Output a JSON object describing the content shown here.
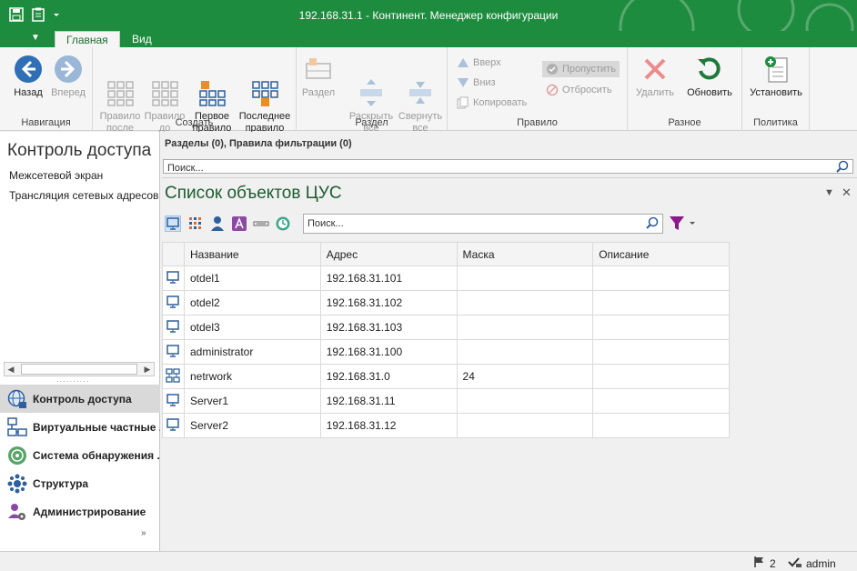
{
  "window": {
    "title": "192.168.31.1 - Континент. Менеджер конфигурации"
  },
  "ribbon": {
    "tabs": [
      {
        "label": "Главная",
        "active": true
      },
      {
        "label": "Вид",
        "active": false
      }
    ],
    "groups": {
      "navigation": {
        "label": "Навигация",
        "back": "Назад",
        "forward": "Вперед"
      },
      "create": {
        "label": "Создать",
        "rule_after": "Правило\nпосле",
        "rule_before": "Правило\nдо",
        "first_rule": "Первое\nправило",
        "last_rule": "Последнее\nправило"
      },
      "section": {
        "label": "Раздел",
        "section": "Раздел",
        "expand_all": "Раскрыть\nвсе",
        "collapse_all": "Свернуть\nвсе"
      },
      "rule": {
        "label": "Правило",
        "up": "Вверх",
        "down": "Вниз",
        "copy": "Копировать",
        "pass": "Пропустить",
        "drop": "Отбросить"
      },
      "misc": {
        "label": "Разное",
        "delete": "Удалить",
        "refresh": "Обновить"
      },
      "policy": {
        "label": "Политика",
        "install": "Установить"
      }
    }
  },
  "left_panel": {
    "title": "Контроль доступа",
    "tree": [
      "Межсетевой экран",
      "Трансляция сетевых адресов"
    ],
    "nav": [
      {
        "label": "Контроль доступа",
        "icon": "globe-lock-icon",
        "active": true
      },
      {
        "label": "Виртуальные частные ...",
        "icon": "network-icon",
        "active": false
      },
      {
        "label": "Система обнаружения ...",
        "icon": "radar-icon",
        "active": false
      },
      {
        "label": "Структура",
        "icon": "structure-icon",
        "active": false
      },
      {
        "label": "Администрирование",
        "icon": "admin-user-icon",
        "active": false
      }
    ]
  },
  "sections": {
    "header": "Разделы (0), Правила фильтрации (0)",
    "search_placeholder": "Поиск..."
  },
  "objects_panel": {
    "title": "Список объектов ЦУС",
    "search_placeholder": "Поиск...",
    "columns": [
      "Название",
      "Адрес",
      "Маска",
      "Описание"
    ],
    "rows": [
      {
        "type": "host",
        "name": "otdel1",
        "address": "192.168.31.101",
        "mask": "",
        "description": ""
      },
      {
        "type": "host",
        "name": "otdel2",
        "address": "192.168.31.102",
        "mask": "",
        "description": ""
      },
      {
        "type": "host",
        "name": "otdel3",
        "address": "192.168.31.103",
        "mask": "",
        "description": ""
      },
      {
        "type": "host",
        "name": "administrator",
        "address": "192.168.31.100",
        "mask": "",
        "description": ""
      },
      {
        "type": "network",
        "name": "netrwork",
        "address": "192.168.31.0",
        "mask": "24",
        "description": ""
      },
      {
        "type": "host",
        "name": "Server1",
        "address": "192.168.31.11",
        "mask": "",
        "description": ""
      },
      {
        "type": "host",
        "name": "Server2",
        "address": "192.168.31.12",
        "mask": "",
        "description": ""
      }
    ]
  },
  "status_bar": {
    "flags": "2",
    "user": "admin"
  },
  "colors": {
    "brand_green": "#1e8c3f",
    "title_green": "#1d5c2f",
    "selection": "#d9d9d9"
  }
}
